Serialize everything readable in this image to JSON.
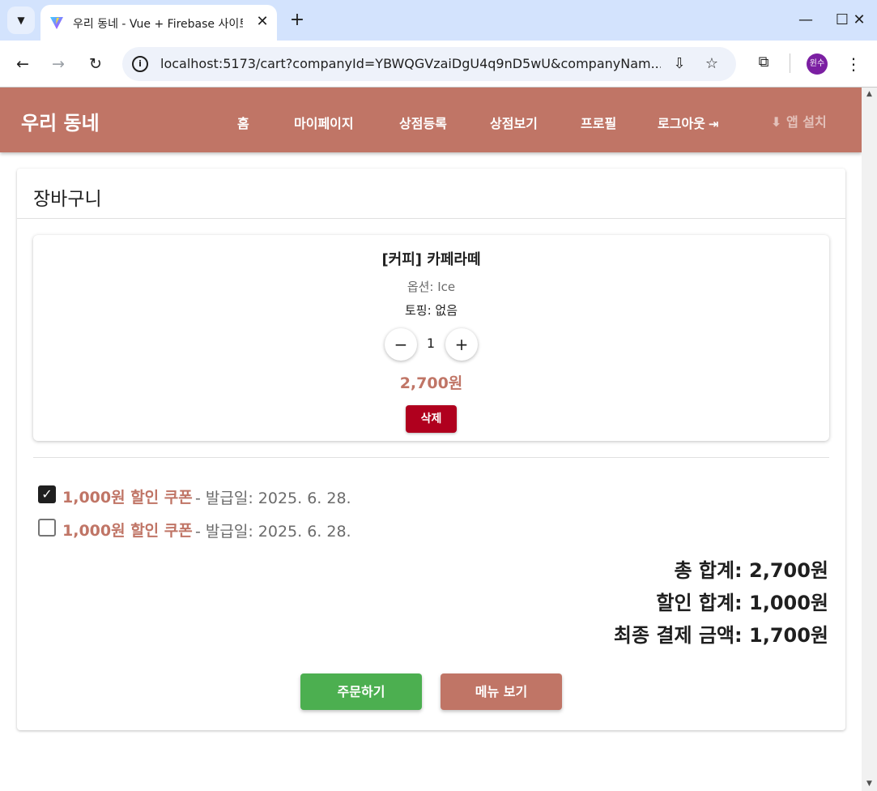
{
  "browser": {
    "tab_title": "우리 동네 - Vue + Firebase 사이트",
    "tab_close": "✕",
    "new_tab": "+",
    "url": "localhost:5173/cart?companyId=YBWQGVzaiDgU4q9nD5wU&companyNam...",
    "profile_initials": "윈수",
    "window": {
      "minimize": "—",
      "maximize": "☐",
      "close": "✕"
    },
    "icons": {
      "tab_menu": "chevron-down-icon",
      "back": "arrow-left-icon",
      "forward": "arrow-right-icon",
      "reload": "reload-icon",
      "site_info": "info-icon",
      "install": "install-app-icon",
      "bookmark": "star-icon",
      "extensions": "puzzle-icon",
      "menu": "more-vertical-icon"
    }
  },
  "app": {
    "brand": "우리 동네",
    "nav": [
      {
        "label": "홈"
      },
      {
        "label": "마이페이지"
      },
      {
        "label": "상점등록"
      },
      {
        "label": "상점보기"
      },
      {
        "label": "프로필"
      },
      {
        "label": "로그아웃"
      }
    ],
    "logout_icon": "logout-icon",
    "install_label": "앱 설치",
    "install_icon": "download-icon",
    "colors": {
      "primary": "#c07566",
      "order": "#4caf50",
      "delete": "#b0001e"
    }
  },
  "cart": {
    "title": "장바구니",
    "items": [
      {
        "name": "[커피] 카페라떼",
        "option": "옵션: Ice",
        "topping": "토핑: 없음",
        "quantity": "1",
        "price": "2,700원",
        "delete_label": "삭제",
        "minus_label": "−",
        "plus_label": "+"
      }
    ],
    "coupons": [
      {
        "checked": true,
        "name": "1,000원 할인 쿠폰",
        "issued": "- 발급일: 2025. 6. 28."
      },
      {
        "checked": false,
        "name": "1,000원 할인 쿠폰",
        "issued": "- 발급일: 2025. 6. 28."
      }
    ],
    "summary": {
      "total": "총 합계: 2,700원",
      "discount": "할인 합계: 1,000원",
      "final": "최종 결제 금액: 1,700원"
    },
    "order_label": "주문하기",
    "menu_label": "메뉴 보기"
  }
}
